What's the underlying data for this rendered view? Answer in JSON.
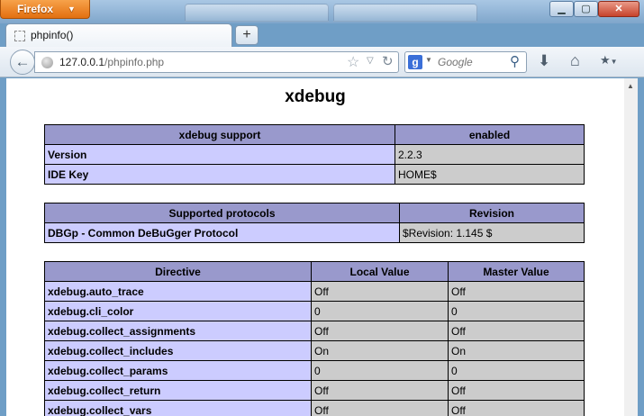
{
  "browser": {
    "app_button": "Firefox",
    "tab_title": "phpinfo()",
    "new_tab": "+",
    "url_host": "127.0.0.1",
    "url_path": "/phpinfo.php",
    "search_placeholder": "Google",
    "icons": [
      "firefox-menu",
      "back-arrow",
      "site-identity",
      "bookmark-star",
      "history-dropmarker",
      "reload",
      "google-engine",
      "search-magnifier",
      "downloads-arrow",
      "home",
      "bookmarks-menu",
      "minimize",
      "maximize",
      "close"
    ]
  },
  "page": {
    "title": "xdebug",
    "support_table": {
      "headers": [
        "xdebug support",
        "enabled"
      ],
      "rows": [
        [
          "Version",
          "2.2.3"
        ],
        [
          "IDE Key",
          "HOME$"
        ]
      ]
    },
    "protocols_table": {
      "headers": [
        "Supported protocols",
        "Revision"
      ],
      "rows": [
        [
          "DBGp - Common DeBuGger Protocol",
          "$Revision: 1.145 $"
        ]
      ]
    },
    "directives_table": {
      "headers": [
        "Directive",
        "Local Value",
        "Master Value"
      ],
      "rows": [
        [
          "xdebug.auto_trace",
          "Off",
          "Off"
        ],
        [
          "xdebug.cli_color",
          "0",
          "0"
        ],
        [
          "xdebug.collect_assignments",
          "Off",
          "Off"
        ],
        [
          "xdebug.collect_includes",
          "On",
          "On"
        ],
        [
          "xdebug.collect_params",
          "0",
          "0"
        ],
        [
          "xdebug.collect_return",
          "Off",
          "Off"
        ],
        [
          "xdebug.collect_vars",
          "Off",
          "Off"
        ]
      ]
    }
  },
  "colors": {
    "table_header": "#9999cc",
    "table_key_cell": "#ccccff",
    "table_value_cell": "#cccccc",
    "firefox_button": "#e26f10"
  }
}
